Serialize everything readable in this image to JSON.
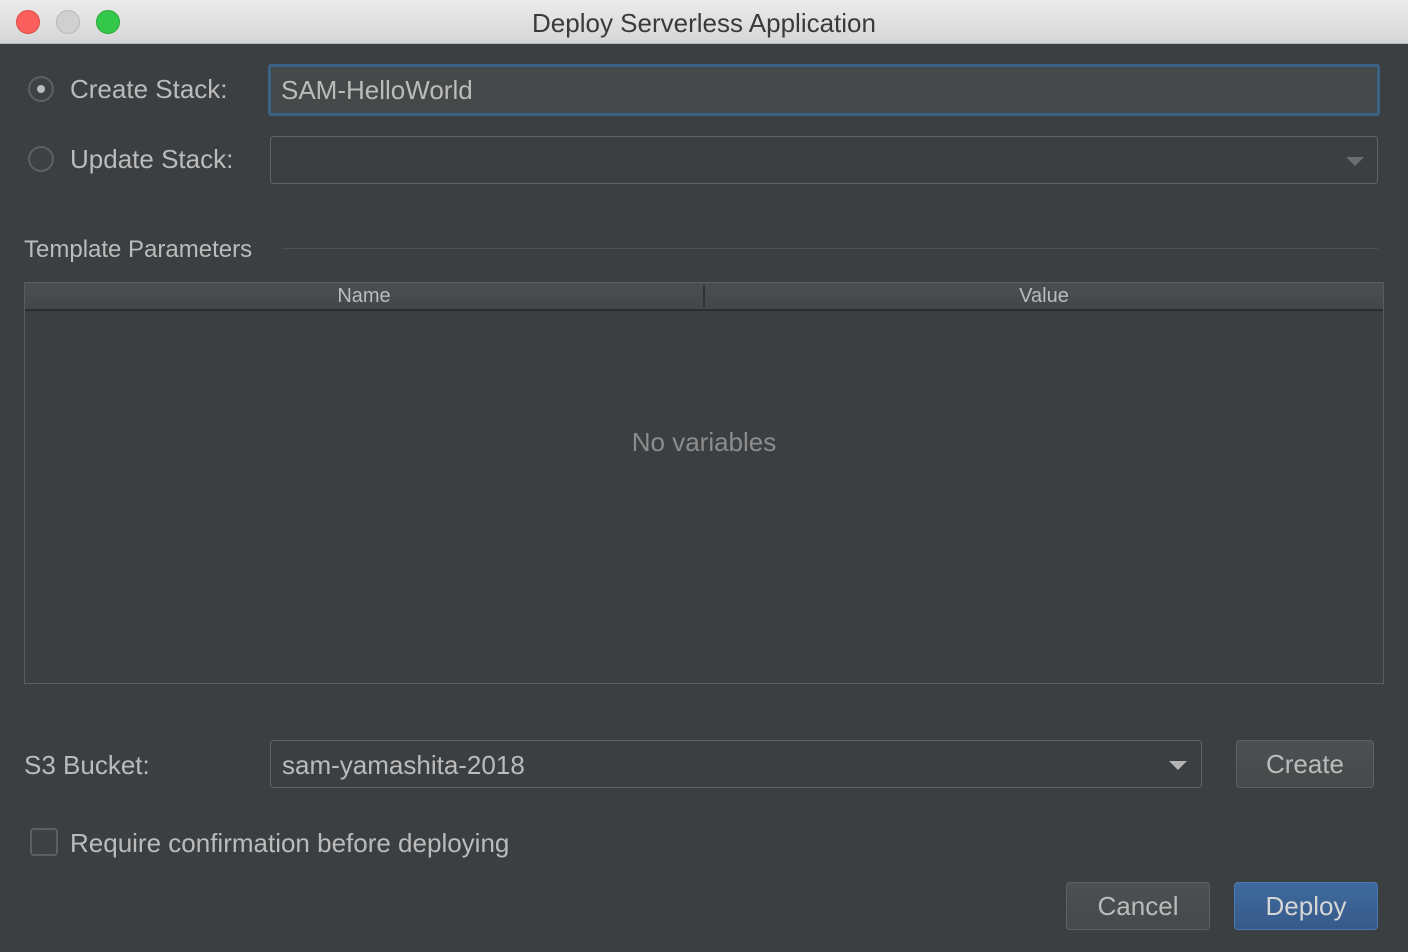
{
  "window": {
    "title": "Deploy Serverless Application"
  },
  "stack": {
    "create_label": "Create Stack:",
    "create_value": "SAM-HelloWorld",
    "create_selected": true,
    "update_label": "Update Stack:",
    "update_value": ""
  },
  "template_parameters": {
    "section_title": "Template Parameters",
    "columns": [
      "Name",
      "Value"
    ],
    "rows": [],
    "empty_text": "No variables"
  },
  "s3": {
    "label": "S3 Bucket:",
    "value": "sam-yamashita-2018",
    "create_button": "Create"
  },
  "confirmation": {
    "label": "Require confirmation before deploying",
    "checked": false
  },
  "footer": {
    "cancel_label": "Cancel",
    "deploy_label": "Deploy"
  },
  "colors": {
    "background": "#3c3f41",
    "accent": "#365a8a",
    "focus_border": "#3d6185"
  }
}
